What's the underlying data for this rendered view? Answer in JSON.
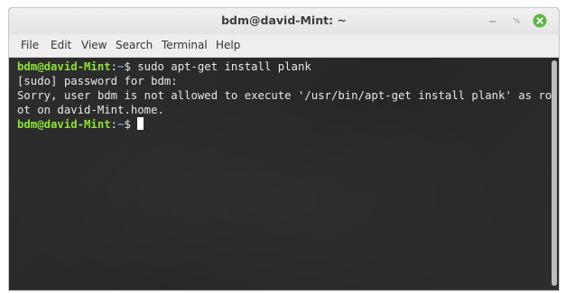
{
  "window": {
    "title": "bdm@david-Mint: ~"
  },
  "menu": {
    "items": [
      "File",
      "Edit",
      "View",
      "Search",
      "Terminal",
      "Help"
    ]
  },
  "terminal": {
    "line1": {
      "user": "bdm@david-Mint",
      "sep": ":",
      "path": "~",
      "end": "$",
      "cmd": " sudo apt-get install plank"
    },
    "line2": "[sudo] password for bdm:",
    "line3": "Sorry, user bdm is not allowed to execute '/usr/bin/apt-get install plank' as ro",
    "line4": "ot on david-Mint.home.",
    "line5": {
      "user": "bdm@david-Mint",
      "sep": ":",
      "path": "~",
      "end": "$",
      "cmd": " "
    }
  },
  "colors": {
    "prompt_user": "#8ae234",
    "prompt_path": "#729fcf",
    "close_button": "#5fb546"
  },
  "icons": [
    "minimize-icon",
    "maximize-icon",
    "close-icon"
  ]
}
